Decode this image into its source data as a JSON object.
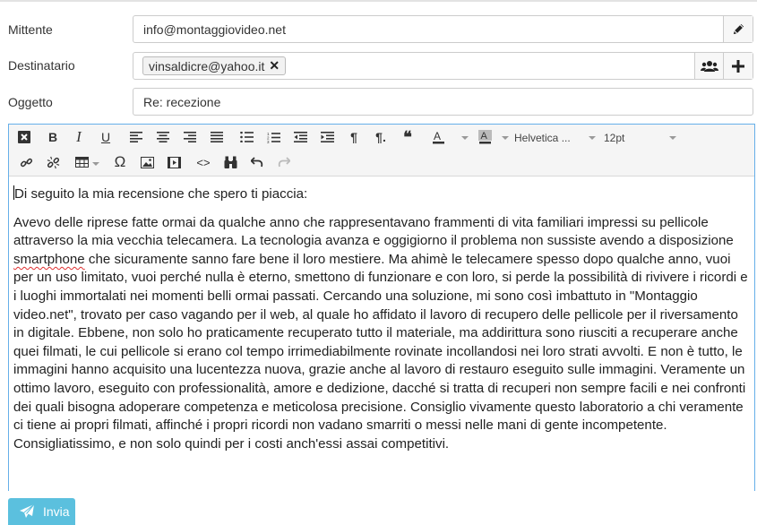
{
  "form": {
    "sender_label": "Mittente",
    "sender_value": "info@montaggiovideo.net",
    "recipient_label": "Destinatario",
    "recipient_chip": "vinsaldicre@yahoo.it",
    "subject_label": "Oggetto",
    "subject_value": "Re: recezione"
  },
  "toolbar": {
    "font_family": "Helvetica ...",
    "font_size": "12pt"
  },
  "body": {
    "greeting": "Di seguito la mia recensione che spero ti piaccia:",
    "para_before": "Avevo delle riprese fatte ormai da qualche anno che rappresentavano frammenti di vita familiari impressi su pellicole attraverso la mia vecchia telecamera.  La tecnologia avanza e oggigiorno il problema non sussiste avendo a disposizione ",
    "para_misspelled": "smartphone",
    "para_after": " che sicuramente sanno fare bene il loro mestiere. Ma ahimè le telecamere spesso dopo qualche anno, vuoi per un uso limitato, vuoi perché nulla è eterno, smettono di funzionare e con loro, si perde la possibilità di rivivere i ricordi e i luoghi immortalati nei momenti belli ormai passati. Cercando una soluzione, mi sono così imbattuto in \"Montaggio video.net\", trovato per caso vagando per il web, al quale ho affidato il lavoro di recupero delle pellicole per il riversamento in digitale. Ebbene, non solo ho praticamente recuperato tutto il materiale, ma addirittura sono riusciti a recuperare anche quei filmati, le cui pellicole si erano col tempo irrimediabilmente rovinate incollandosi nei loro strati avvolti. E non è tutto, le immagini hanno acquisito una lucentezza nuova, grazie anche al lavoro di restauro eseguito sulle immagini. Veramente un ottimo lavoro, eseguito con professionalità, amore e dedizione, dacché si tratta di recuperi non sempre facili e nei confronti dei quali bisogna adoperare competenza e meticolosa precisione. Consiglio vivamente questo laboratorio a chi veramente ci tiene ai propri filmati, affinché i propri ricordi non vadano smarriti o messi nelle mani di gente incompetente. Consigliatissimo, e non solo quindi per i costi anch'essi assai competitivi."
  },
  "actions": {
    "send_label": "Invia"
  },
  "colors": {
    "accent": "#5bc0de",
    "focus_border": "#66afe9"
  }
}
